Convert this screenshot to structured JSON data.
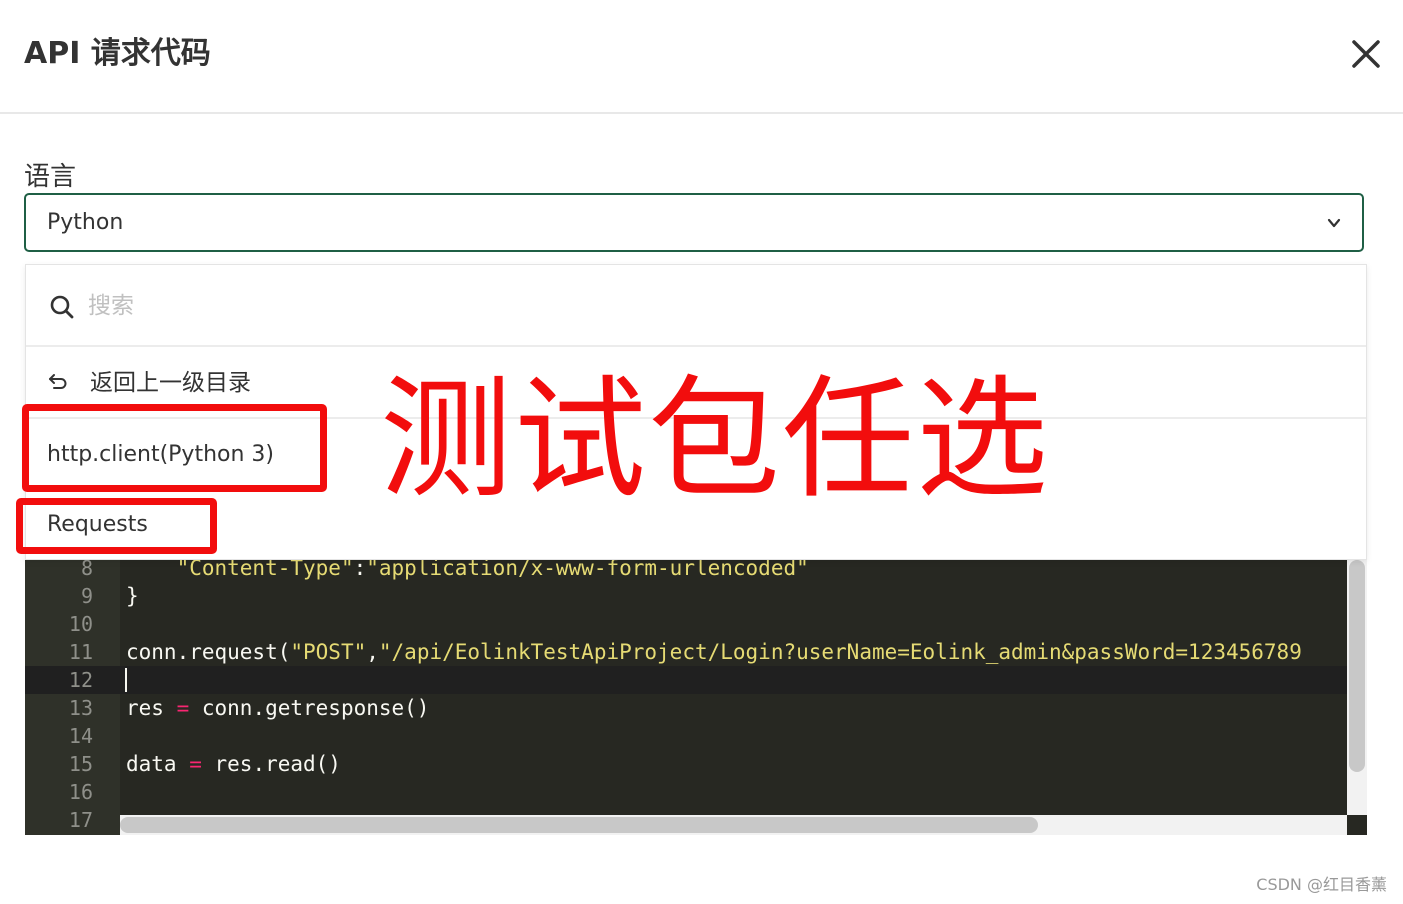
{
  "dialog": {
    "title": "API 请求代码"
  },
  "language": {
    "label": "语言",
    "selected": "Python"
  },
  "dropdown": {
    "search_placeholder": "搜索",
    "back_label": "返回上一级目录",
    "options": [
      "http.client(Python 3)",
      "Requests"
    ]
  },
  "code": {
    "lines": [
      {
        "n": "8",
        "parts": [
          {
            "t": "    "
          },
          {
            "t": "\"Content-Type\"",
            "c": "str"
          },
          {
            "t": ":"
          },
          {
            "t": "\"application/x-www-form-urlencoded\"",
            "c": "str"
          }
        ]
      },
      {
        "n": "9",
        "parts": [
          {
            "t": "}"
          }
        ]
      },
      {
        "n": "10",
        "parts": []
      },
      {
        "n": "11",
        "parts": [
          {
            "t": "conn.request("
          },
          {
            "t": "\"POST\"",
            "c": "str"
          },
          {
            "t": ","
          },
          {
            "t": "\"/api/EolinkTestApiProject/Login?userName=Eolink_admin&passWord=123456789",
            "c": "str"
          }
        ]
      },
      {
        "n": "12",
        "parts": []
      },
      {
        "n": "13",
        "parts": [
          {
            "t": "res "
          },
          {
            "t": "=",
            "c": "op"
          },
          {
            "t": " conn.getresponse()"
          }
        ]
      },
      {
        "n": "14",
        "parts": []
      },
      {
        "n": "15",
        "parts": [
          {
            "t": "data "
          },
          {
            "t": "=",
            "c": "op"
          },
          {
            "t": " res.read()"
          }
        ]
      },
      {
        "n": "16",
        "parts": []
      },
      {
        "n": "17",
        "parts": []
      }
    ]
  },
  "annotation": {
    "text": "测试包任选"
  },
  "watermark": "CSDN @红目香薰",
  "colors": {
    "annotation_red": "#f20d0d",
    "select_border": "#1f5f45",
    "editor_bg": "#272822",
    "string": "#e6db74",
    "operator": "#f92672"
  }
}
